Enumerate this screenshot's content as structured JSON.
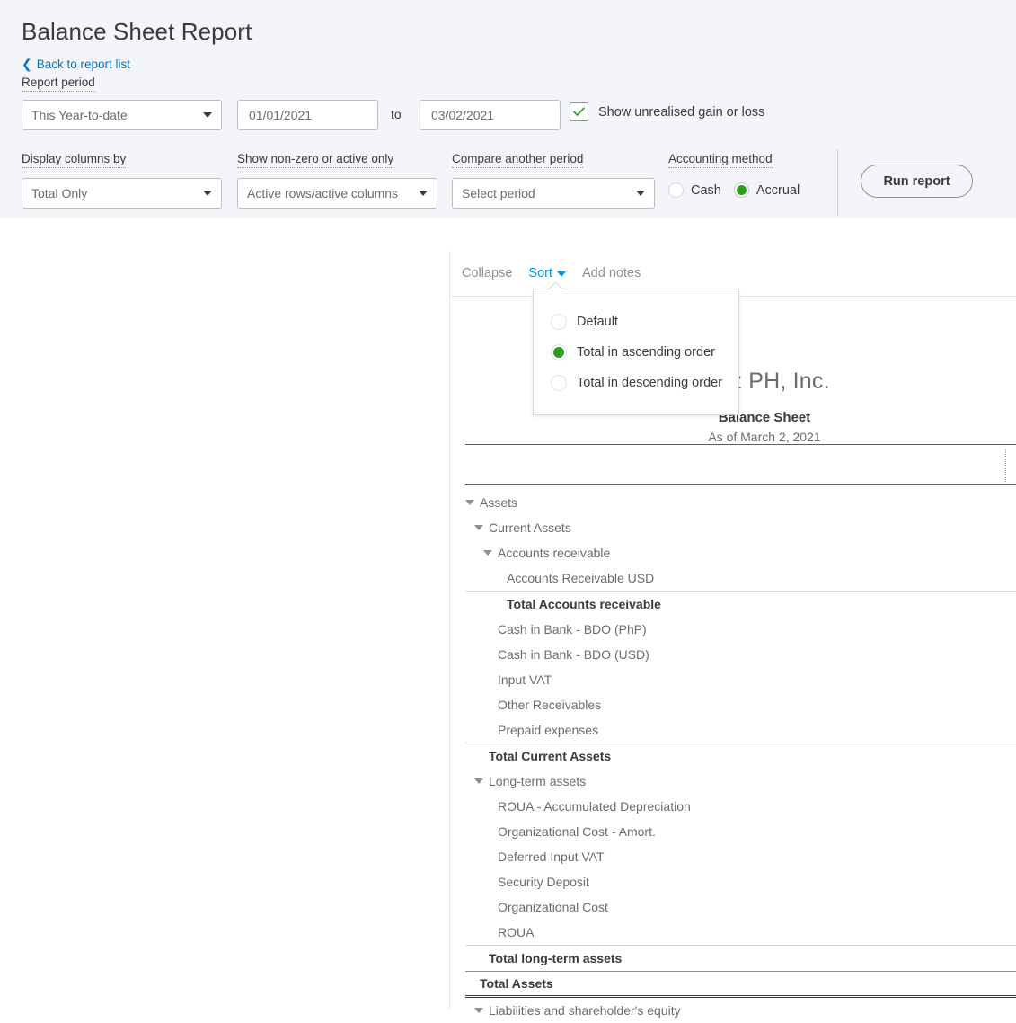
{
  "header": {
    "title": "Balance Sheet Report",
    "back_link": "Back to report list",
    "back_icon": "chevron-left-icon"
  },
  "filters": {
    "report_period_label": "Report period",
    "report_period_value": "This Year-to-date",
    "date_from": "01/01/2021",
    "date_to_separator": "to",
    "date_to": "03/02/2021",
    "unrealised_checkbox_label": "Show unrealised gain or loss",
    "unrealised_checked": true,
    "display_columns_label": "Display columns by",
    "display_columns_value": "Total Only",
    "non_zero_label": "Show non-zero or active only",
    "non_zero_value": "Active rows/active columns",
    "compare_label": "Compare another period",
    "compare_value": "Select period",
    "accounting_method_label": "Accounting method",
    "accounting_options": [
      "Cash",
      "Accrual"
    ],
    "accounting_selected": "Accrual",
    "run_report_label": "Run report"
  },
  "toolbar": {
    "collapse_label": "Collapse",
    "sort_label": "Sort",
    "add_notes_label": "Add notes"
  },
  "sort_menu": {
    "options": [
      {
        "label": "Default",
        "selected": false
      },
      {
        "label": "Total in ascending order",
        "selected": true
      },
      {
        "label": "Total in descending order",
        "selected": false
      }
    ]
  },
  "report": {
    "company_name": "mez PH, Inc.",
    "report_name": "Balance Sheet",
    "as_of": "As of March 2, 2021"
  },
  "rows": [
    {
      "label": "Assets",
      "indent": 0,
      "type": "group",
      "expandable": true
    },
    {
      "label": "Current Assets",
      "indent": 1,
      "type": "group",
      "expandable": true
    },
    {
      "label": "Accounts receivable",
      "indent": 2,
      "type": "group",
      "expandable": true
    },
    {
      "label": "Accounts Receivable USD",
      "indent": 4,
      "type": "detail",
      "expandable": false
    },
    {
      "label": "Total Accounts receivable",
      "indent": 4,
      "type": "total",
      "expandable": false
    },
    {
      "label": "Cash in Bank - BDO (PhP)",
      "indent": 3,
      "type": "detail",
      "expandable": false
    },
    {
      "label": "Cash in Bank - BDO (USD)",
      "indent": 3,
      "type": "detail",
      "expandable": false
    },
    {
      "label": "Input VAT",
      "indent": 3,
      "type": "detail",
      "expandable": false
    },
    {
      "label": "Other Receivables",
      "indent": 3,
      "type": "detail",
      "expandable": false
    },
    {
      "label": "Prepaid expenses",
      "indent": 3,
      "type": "detail",
      "expandable": false
    },
    {
      "label": "Total Current Assets",
      "indent": 2,
      "type": "total",
      "expandable": false
    },
    {
      "label": "Long-term assets",
      "indent": 1,
      "type": "group",
      "expandable": true
    },
    {
      "label": "ROUA - Accumulated Depreciation",
      "indent": 3,
      "type": "detail",
      "expandable": false
    },
    {
      "label": "Organizational Cost - Amort.",
      "indent": 3,
      "type": "detail",
      "expandable": false
    },
    {
      "label": "Deferred Input VAT",
      "indent": 3,
      "type": "detail",
      "expandable": false
    },
    {
      "label": "Security Deposit",
      "indent": 3,
      "type": "detail",
      "expandable": false
    },
    {
      "label": "Organizational Cost",
      "indent": 3,
      "type": "detail",
      "expandable": false
    },
    {
      "label": "ROUA",
      "indent": 3,
      "type": "detail",
      "expandable": false
    },
    {
      "label": "Total long-term assets",
      "indent": 2,
      "type": "total",
      "expandable": false
    },
    {
      "label": "Total Assets",
      "indent": 1,
      "type": "grand",
      "expandable": false
    },
    {
      "label": "Liabilities and shareholder's equity",
      "indent": 1,
      "type": "group",
      "expandable": true
    }
  ],
  "colors": {
    "accent_blue": "#0077c5",
    "link_blue": "#0097e6",
    "green": "#2ca01c",
    "panel_bg": "#f4f5f8",
    "text": "#393a3d",
    "muted": "#6b6c72"
  }
}
